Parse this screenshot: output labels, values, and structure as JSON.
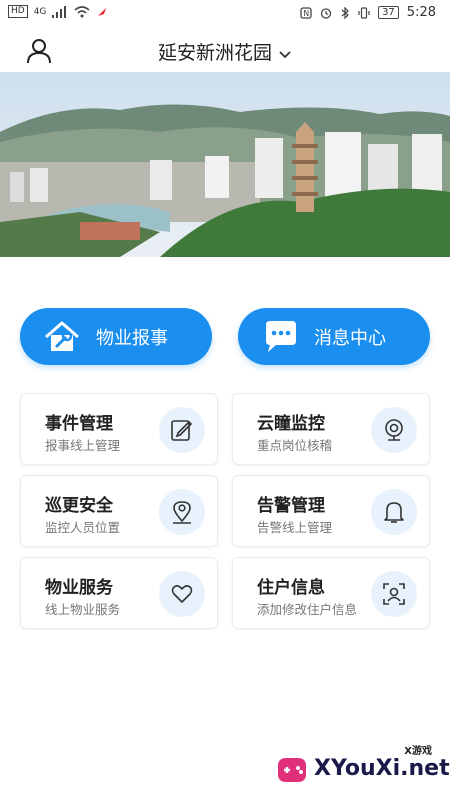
{
  "status_bar": {
    "hd_badge": "HD",
    "network": "4G",
    "battery": "37",
    "time": "5:28"
  },
  "header": {
    "title": "延安新洲花园"
  },
  "big_buttons": [
    {
      "label": "物业报事",
      "icon": "house-wrench-icon"
    },
    {
      "label": "消息中心",
      "icon": "chat-bubble-icon"
    }
  ],
  "cards": [
    {
      "title": "事件管理",
      "subtitle": "报事线上管理",
      "icon": "edit-document-icon"
    },
    {
      "title": "云瞳监控",
      "subtitle": "重点岗位核稽",
      "icon": "webcam-icon"
    },
    {
      "title": "巡更安全",
      "subtitle": "监控人员位置",
      "icon": "location-pin-icon"
    },
    {
      "title": "告警管理",
      "subtitle": "告警线上管理",
      "icon": "bell-icon"
    },
    {
      "title": "物业服务",
      "subtitle": "线上物业服务",
      "icon": "heart-icon"
    },
    {
      "title": "住户信息",
      "subtitle": "添加修改住户信息",
      "icon": "face-scan-icon"
    }
  ],
  "watermark": {
    "small": "X游戏",
    "text": "XYouXi.net"
  },
  "colors": {
    "accent": "#1b8ff0",
    "icon_bg": "#e8f2fd"
  }
}
